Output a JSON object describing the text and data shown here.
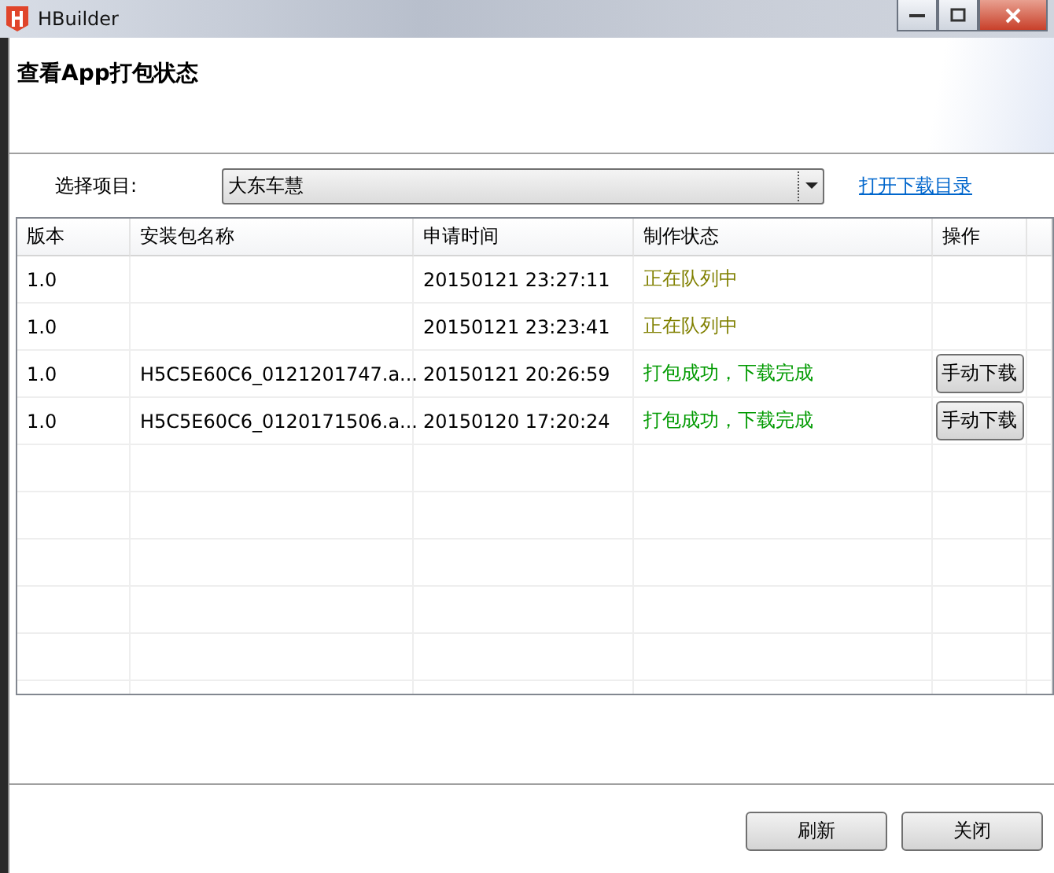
{
  "window": {
    "title": "HBuilder"
  },
  "header": {
    "title": "查看App打包状态"
  },
  "project": {
    "label": "选择项目:",
    "value": "大东车慧",
    "link": "打开下载目录"
  },
  "table": {
    "columns": [
      "版本",
      "安装包名称",
      "申请时间",
      "制作状态",
      "操作"
    ],
    "rows": [
      {
        "version": "1.0",
        "package": "",
        "time": "20150121 23:27:11",
        "status": "正在队列中",
        "color": "#808000"
      },
      {
        "version": "1.0",
        "package": "",
        "time": "20150121 23:23:41",
        "status": "正在队列中",
        "color": "#808000"
      },
      {
        "version": "1.0",
        "package": "H5C5E60C6_0121201747.a...",
        "time": "20150121 20:26:59",
        "status": "打包成功，下载完成",
        "color": "#009a00",
        "action": "手动下载"
      },
      {
        "version": "1.0",
        "package": "H5C5E60C6_0120171506.a...",
        "time": "20150120 17:20:24",
        "status": "打包成功，下载完成",
        "color": "#009a00",
        "action": "手动下载"
      }
    ]
  },
  "buttons": [
    "刷新",
    "关闭"
  ]
}
